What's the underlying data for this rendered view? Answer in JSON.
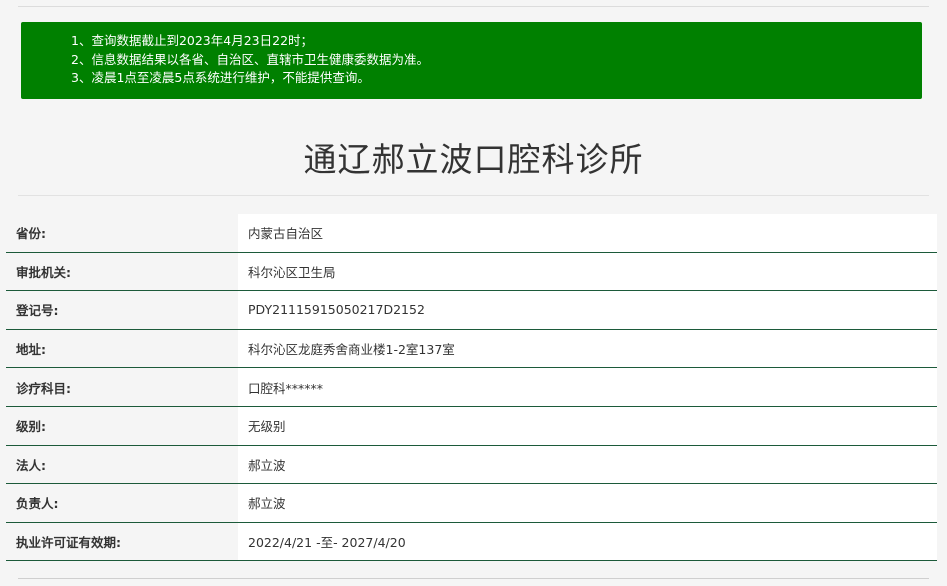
{
  "notice": {
    "lines": [
      "1、查询数据截止到2023年4月23日22时；",
      "2、信息数据结果以各省、自治区、直辖市卫生健康委数据为准。",
      "3、凌晨1点至凌晨5点系统进行维护，不能提供查询。"
    ],
    "background_color": "#008000"
  },
  "page_title": "通辽郝立波口腔科诊所",
  "table": {
    "rows": [
      {
        "label": "省份:",
        "value": "内蒙古自治区"
      },
      {
        "label": "审批机关:",
        "value": "科尔沁区卫生局"
      },
      {
        "label": "登记号:",
        "value": "PDY21115915050217D2152"
      },
      {
        "label": "地址:",
        "value": "科尔沁区龙庭秀舍商业楼1-2室137室"
      },
      {
        "label": "诊疗科目:",
        "value": "口腔科******"
      },
      {
        "label": "级别:",
        "value": "无级别"
      },
      {
        "label": "法人:",
        "value": "郝立波"
      },
      {
        "label": "负责人:",
        "value": "郝立波"
      },
      {
        "label": "执业许可证有效期:",
        "value": "2022/4/21 -至- 2027/4/20"
      }
    ],
    "divider_color": "#1c5a3a"
  }
}
